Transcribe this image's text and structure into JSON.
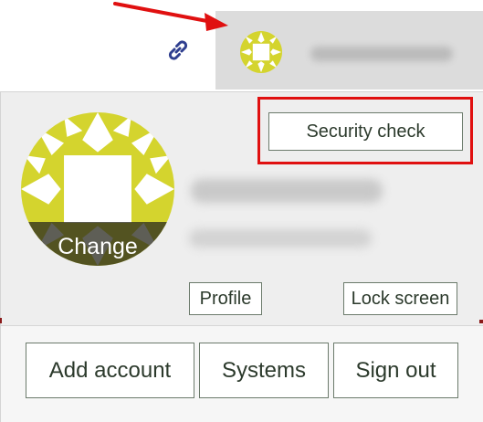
{
  "colors": {
    "avatar_fill": "#d4d42e",
    "avatar_shape": "#ffffff",
    "highlight": "#e01010",
    "arrow": "#e01010",
    "link_icon": "#2f3f8f"
  },
  "topbar": {
    "link_icon": "link-icon"
  },
  "profile": {
    "change_label": "Change"
  },
  "actions": {
    "security_check": "Security check",
    "profile": "Profile",
    "lock_screen": "Lock screen"
  },
  "footer": {
    "add_account": "Add account",
    "systems": "Systems",
    "sign_out": "Sign out"
  }
}
